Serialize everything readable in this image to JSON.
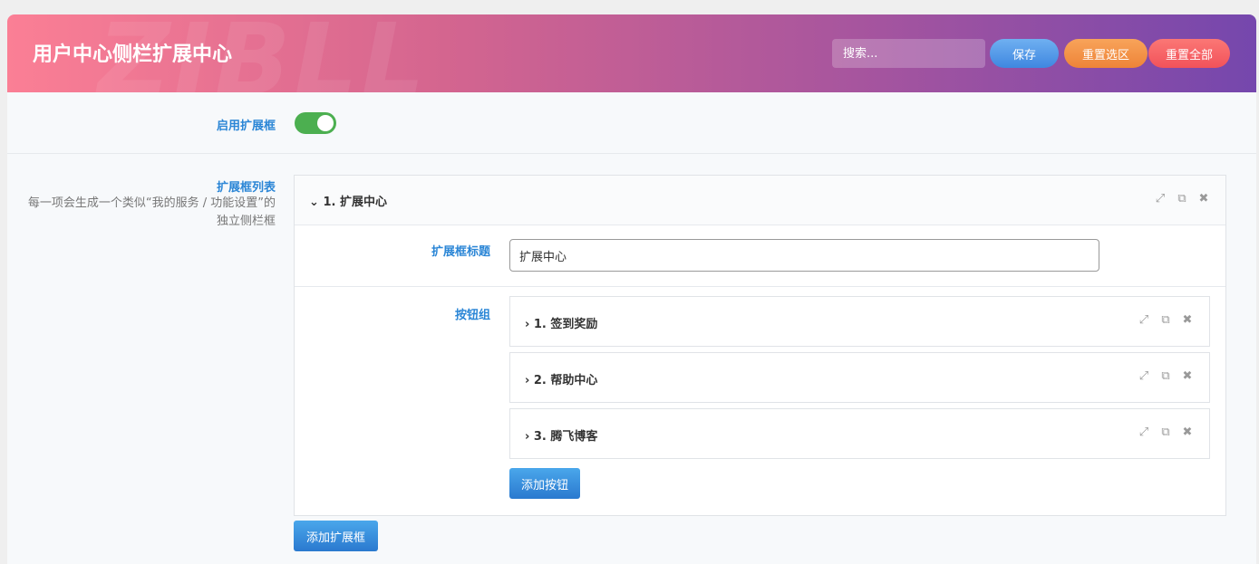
{
  "header": {
    "title": "用户中心侧栏扩展中心",
    "watermark": "ZIBLL",
    "search_placeholder": "搜索...",
    "save_label": "保存",
    "reset_section_label": "重置选区",
    "reset_all_label": "重置全部",
    "gradient_colors": [
      "#fb7f95",
      "#7547ad"
    ]
  },
  "enable": {
    "label": "启用扩展框",
    "enabled": true,
    "toggle_color": "#4caf50"
  },
  "list": {
    "label": "扩展框列表",
    "description": "每一项会生成一个类似“我的服务 / 功能设置”的独立侧栏框",
    "add_box_label": "添加扩展框",
    "items": [
      {
        "header": "1. 扩展中心",
        "expanded": true,
        "title_label": "扩展框标题",
        "title_value": "扩展中心",
        "buttons_label": "按钮组",
        "add_button_label": "添加按钮",
        "buttons": [
          {
            "header": "1. 签到奖励"
          },
          {
            "header": "2. 帮助中心"
          },
          {
            "header": "3. 腾飞博客"
          }
        ]
      }
    ]
  },
  "icons": {
    "expanded_chevron": "⌄",
    "collapsed_chevron": "›",
    "expand_icon": "⤢",
    "copy_icon": "⧉",
    "close_icon": "✖"
  },
  "accent_color": "#2b86d6"
}
